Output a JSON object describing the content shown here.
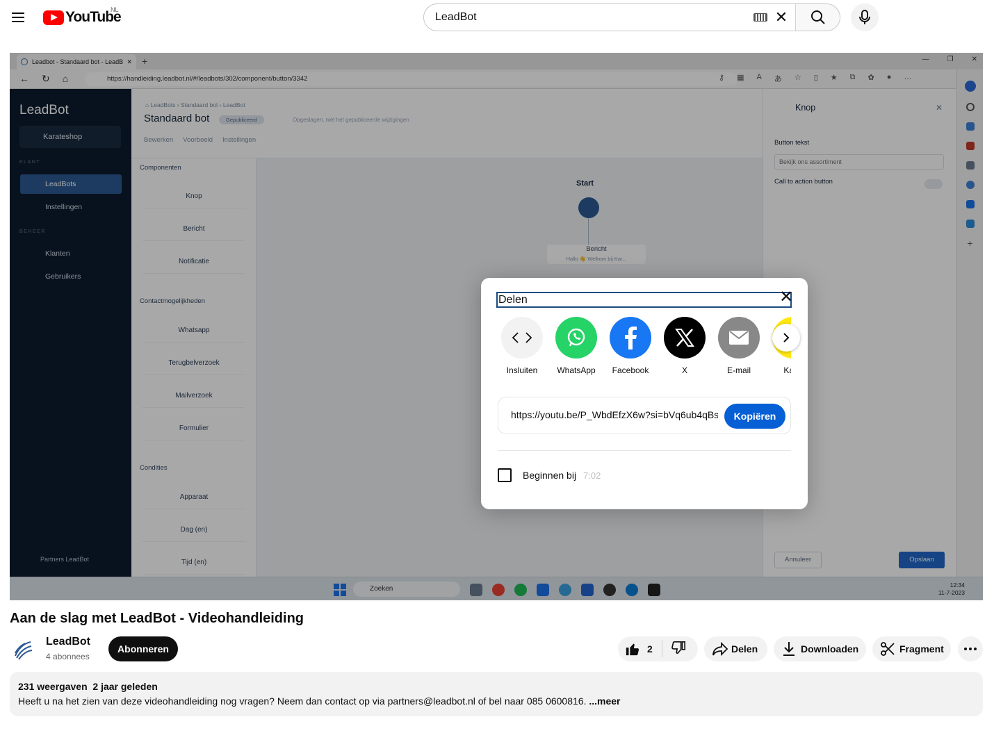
{
  "header": {
    "logo_text": "YouTube",
    "country_code": "NL",
    "search_value": "LeadBot"
  },
  "browser": {
    "tab_title": "Leadbot - Standaard bot - LeadB",
    "url": "https://handleiding.leadbot.nl/#/leadbots/302/component/button/3342"
  },
  "leadbot": {
    "brand": "LeadBot",
    "workspace": "Karateshop",
    "section_klant": "KLANT",
    "section_beheer": "BEHEER",
    "nav": [
      {
        "label": "LeadBots"
      },
      {
        "label": "Instellingen"
      },
      {
        "label": "Klanten"
      },
      {
        "label": "Gebruikers"
      }
    ],
    "user": "Partners LeadBot",
    "breadcrumb": "⌂ LeadBots › Standaard bot › LeadBot",
    "title": "Standaard bot",
    "badge": "Gepubliceerd",
    "note": "Opgeslagen, niet het gepubliceerde wijzigingen",
    "tabs": [
      "Bewerken",
      "Voorbeeld",
      "Instellingen"
    ],
    "groups": [
      "Componenten",
      "Contactmogelijkheden",
      "Condities"
    ],
    "components": [
      "Knop",
      "Bericht",
      "Notificatie",
      "Whatsapp",
      "Terugbelverzoek",
      "Mailverzoek",
      "Formulier",
      "Apparaat",
      "Dag (en)",
      "Tijd (en)"
    ],
    "canvas_start": "Start",
    "canvas_node": "Bericht",
    "canvas_node_sub": "Hallo 👋 Welkom bij Kar...",
    "panel_title": "Knop",
    "panel_field_label": "Button tekst",
    "panel_field_value": "Bekijk ons assortiment",
    "panel_cta_label": "Call to action button",
    "panel_cancel": "Annuleer",
    "panel_save": "Opslaan"
  },
  "taskbar": {
    "search": "Zoeken",
    "time": "12:34",
    "date": "11-7-2023"
  },
  "share_dialog": {
    "title": "Delen",
    "targets": [
      {
        "label": "Insluiten",
        "color": "#f2f2f2",
        "icon": "embed-icon"
      },
      {
        "label": "WhatsApp",
        "color": "#25d366",
        "icon": "whatsapp-icon"
      },
      {
        "label": "Facebook",
        "color": "#1877f2",
        "icon": "facebook-icon"
      },
      {
        "label": "X",
        "color": "#000000",
        "icon": "x-icon"
      },
      {
        "label": "E-mail",
        "color": "#888888",
        "icon": "email-icon"
      },
      {
        "label": "Kaka",
        "color": "#ffe812",
        "icon": "kakaotalk-icon"
      }
    ],
    "url": "https://youtu.be/P_WbdEfzX6w?si=bVq6ub4qBs",
    "copy_label": "Kopiëren",
    "start_at_label": "Beginnen bij",
    "start_at_time": "7:02"
  },
  "video": {
    "title": "Aan de slag met LeadBot - Videohandleiding",
    "channel": "LeadBot",
    "subscribers": "4 abonnees",
    "subscribe_label": "Abonneren",
    "likes": "2",
    "share_label": "Delen",
    "download_label": "Downloaden",
    "clip_label": "Fragment",
    "views": "231 weergaven",
    "age": "2 jaar geleden",
    "description": "Heeft u na het zien van deze videohandleiding nog vragen? Neem dan contact op via partners@leadbot.nl of bel naar 085 0600816. ",
    "more": "...meer"
  },
  "colors": {
    "youtube_red": "#ff0000",
    "copy_blue": "#065fd4",
    "leadbot_navy": "#0d1c2e",
    "leadbot_blue": "#2c5a93"
  }
}
